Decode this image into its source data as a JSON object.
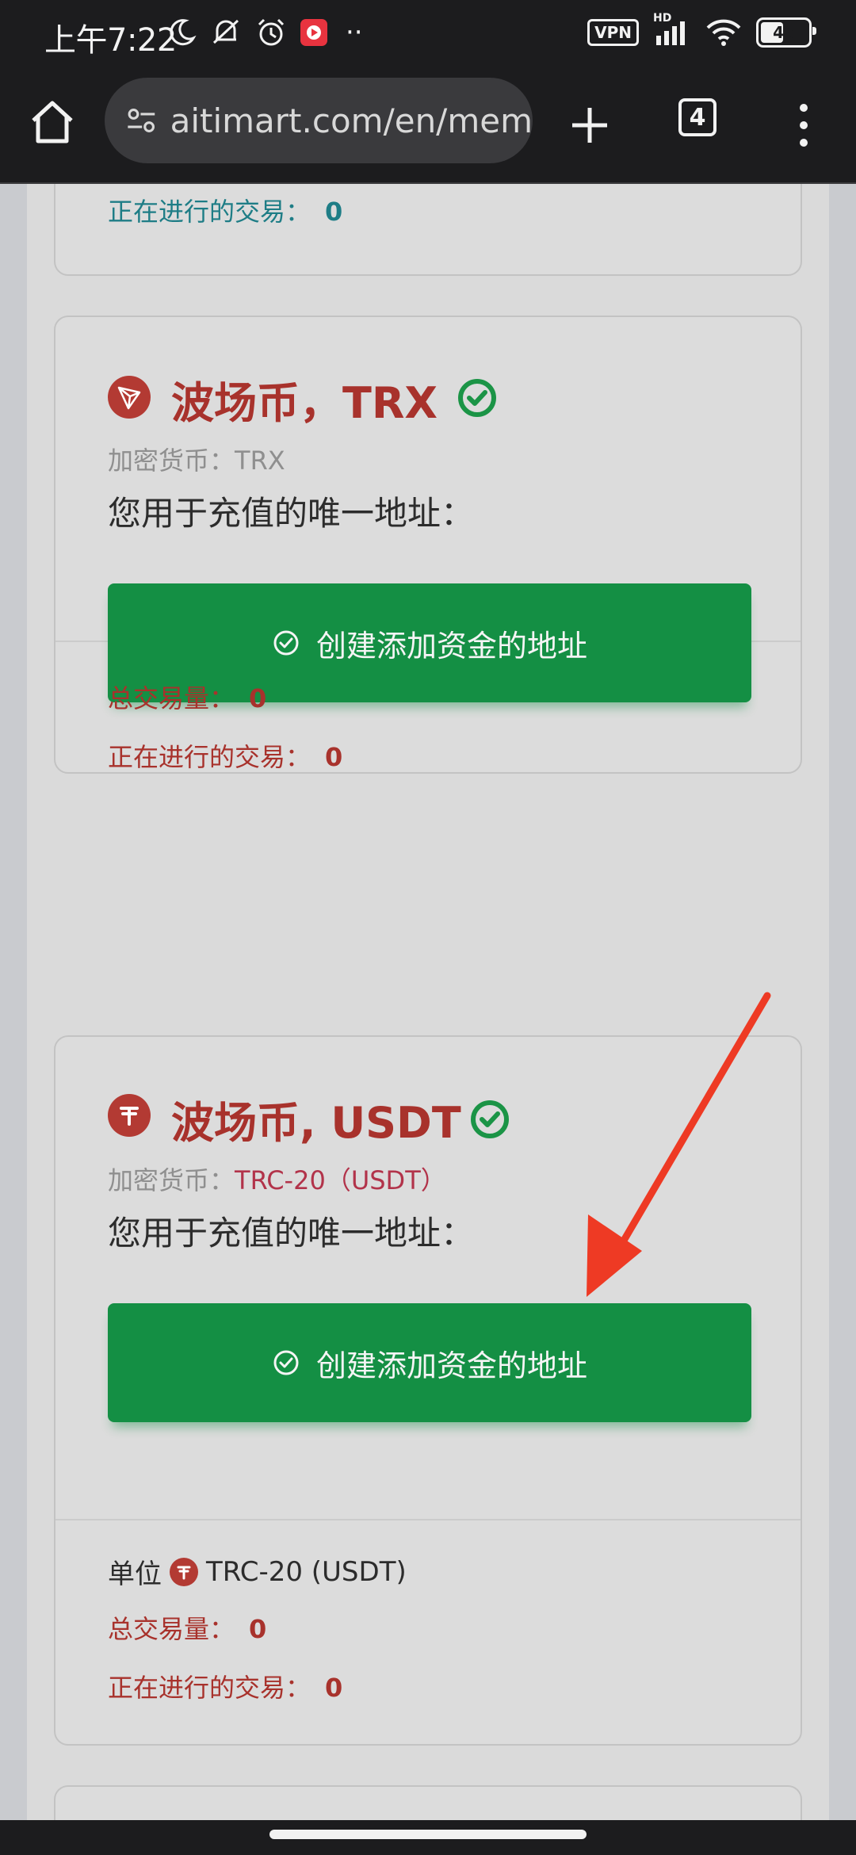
{
  "status_bar": {
    "time": "上午7:22",
    "more_indicator": "··",
    "vpn": "VPN",
    "signal_label": "HD",
    "battery": "46"
  },
  "browser": {
    "url": "aitimart.com/en/mem",
    "tab_count": "4"
  },
  "cards": {
    "prev": {
      "ongoing_label": "正在进行的交易：",
      "ongoing_value": "0"
    },
    "trx": {
      "title": "波场币，TRX",
      "subtitle_label": "加密货币：",
      "subtitle_value": "TRX",
      "address_label": "您用于充值的唯一地址：",
      "button_label": "创建添加资金的地址",
      "total_label": "总交易量：",
      "total_value": "0",
      "ongoing_label": "正在进行的交易：",
      "ongoing_value": "0"
    },
    "usdt": {
      "title": "波场币, USDT",
      "subtitle_label": "加密货币：",
      "subtitle_value": "TRC-20（USDT）",
      "address_label": "您用于充值的唯一地址：",
      "button_label": "创建添加资金的地址",
      "unit_label": "单位",
      "unit_value": "TRC-20 (USDT)",
      "total_label": "总交易量：",
      "total_value": "0",
      "ongoing_label": "正在进行的交易：",
      "ongoing_value": "0"
    }
  },
  "colors": {
    "brand_red": "#a8322c",
    "button_green": "#148f44",
    "verified_green": "#1b9446",
    "arrow_red": "#ee3a24"
  },
  "icons": [
    "home-icon",
    "site-settings-icon",
    "plus-icon",
    "tabs-icon",
    "menu-icon",
    "tron-icon",
    "tether-icon",
    "verified-check-icon",
    "check-circle-icon",
    "arrow-annotation"
  ]
}
